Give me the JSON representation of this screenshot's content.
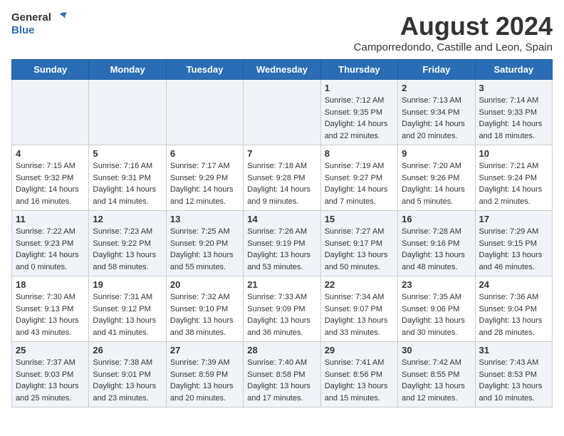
{
  "header": {
    "logo_line1": "General",
    "logo_line2": "Blue",
    "month_year": "August 2024",
    "location": "Camporredondo, Castille and Leon, Spain"
  },
  "weekdays": [
    "Sunday",
    "Monday",
    "Tuesday",
    "Wednesday",
    "Thursday",
    "Friday",
    "Saturday"
  ],
  "weeks": [
    [
      {
        "day": "",
        "info": ""
      },
      {
        "day": "",
        "info": ""
      },
      {
        "day": "",
        "info": ""
      },
      {
        "day": "",
        "info": ""
      },
      {
        "day": "1",
        "info": "Sunrise: 7:12 AM\nSunset: 9:35 PM\nDaylight: 14 hours\nand 22 minutes."
      },
      {
        "day": "2",
        "info": "Sunrise: 7:13 AM\nSunset: 9:34 PM\nDaylight: 14 hours\nand 20 minutes."
      },
      {
        "day": "3",
        "info": "Sunrise: 7:14 AM\nSunset: 9:33 PM\nDaylight: 14 hours\nand 18 minutes."
      }
    ],
    [
      {
        "day": "4",
        "info": "Sunrise: 7:15 AM\nSunset: 9:32 PM\nDaylight: 14 hours\nand 16 minutes."
      },
      {
        "day": "5",
        "info": "Sunrise: 7:16 AM\nSunset: 9:31 PM\nDaylight: 14 hours\nand 14 minutes."
      },
      {
        "day": "6",
        "info": "Sunrise: 7:17 AM\nSunset: 9:29 PM\nDaylight: 14 hours\nand 12 minutes."
      },
      {
        "day": "7",
        "info": "Sunrise: 7:18 AM\nSunset: 9:28 PM\nDaylight: 14 hours\nand 9 minutes."
      },
      {
        "day": "8",
        "info": "Sunrise: 7:19 AM\nSunset: 9:27 PM\nDaylight: 14 hours\nand 7 minutes."
      },
      {
        "day": "9",
        "info": "Sunrise: 7:20 AM\nSunset: 9:26 PM\nDaylight: 14 hours\nand 5 minutes."
      },
      {
        "day": "10",
        "info": "Sunrise: 7:21 AM\nSunset: 9:24 PM\nDaylight: 14 hours\nand 2 minutes."
      }
    ],
    [
      {
        "day": "11",
        "info": "Sunrise: 7:22 AM\nSunset: 9:23 PM\nDaylight: 14 hours\nand 0 minutes."
      },
      {
        "day": "12",
        "info": "Sunrise: 7:23 AM\nSunset: 9:22 PM\nDaylight: 13 hours\nand 58 minutes."
      },
      {
        "day": "13",
        "info": "Sunrise: 7:25 AM\nSunset: 9:20 PM\nDaylight: 13 hours\nand 55 minutes."
      },
      {
        "day": "14",
        "info": "Sunrise: 7:26 AM\nSunset: 9:19 PM\nDaylight: 13 hours\nand 53 minutes."
      },
      {
        "day": "15",
        "info": "Sunrise: 7:27 AM\nSunset: 9:17 PM\nDaylight: 13 hours\nand 50 minutes."
      },
      {
        "day": "16",
        "info": "Sunrise: 7:28 AM\nSunset: 9:16 PM\nDaylight: 13 hours\nand 48 minutes."
      },
      {
        "day": "17",
        "info": "Sunrise: 7:29 AM\nSunset: 9:15 PM\nDaylight: 13 hours\nand 46 minutes."
      }
    ],
    [
      {
        "day": "18",
        "info": "Sunrise: 7:30 AM\nSunset: 9:13 PM\nDaylight: 13 hours\nand 43 minutes."
      },
      {
        "day": "19",
        "info": "Sunrise: 7:31 AM\nSunset: 9:12 PM\nDaylight: 13 hours\nand 41 minutes."
      },
      {
        "day": "20",
        "info": "Sunrise: 7:32 AM\nSunset: 9:10 PM\nDaylight: 13 hours\nand 38 minutes."
      },
      {
        "day": "21",
        "info": "Sunrise: 7:33 AM\nSunset: 9:09 PM\nDaylight: 13 hours\nand 36 minutes."
      },
      {
        "day": "22",
        "info": "Sunrise: 7:34 AM\nSunset: 9:07 PM\nDaylight: 13 hours\nand 33 minutes."
      },
      {
        "day": "23",
        "info": "Sunrise: 7:35 AM\nSunset: 9:06 PM\nDaylight: 13 hours\nand 30 minutes."
      },
      {
        "day": "24",
        "info": "Sunrise: 7:36 AM\nSunset: 9:04 PM\nDaylight: 13 hours\nand 28 minutes."
      }
    ],
    [
      {
        "day": "25",
        "info": "Sunrise: 7:37 AM\nSunset: 9:03 PM\nDaylight: 13 hours\nand 25 minutes."
      },
      {
        "day": "26",
        "info": "Sunrise: 7:38 AM\nSunset: 9:01 PM\nDaylight: 13 hours\nand 23 minutes."
      },
      {
        "day": "27",
        "info": "Sunrise: 7:39 AM\nSunset: 8:59 PM\nDaylight: 13 hours\nand 20 minutes."
      },
      {
        "day": "28",
        "info": "Sunrise: 7:40 AM\nSunset: 8:58 PM\nDaylight: 13 hours\nand 17 minutes."
      },
      {
        "day": "29",
        "info": "Sunrise: 7:41 AM\nSunset: 8:56 PM\nDaylight: 13 hours\nand 15 minutes."
      },
      {
        "day": "30",
        "info": "Sunrise: 7:42 AM\nSunset: 8:55 PM\nDaylight: 13 hours\nand 12 minutes."
      },
      {
        "day": "31",
        "info": "Sunrise: 7:43 AM\nSunset: 8:53 PM\nDaylight: 13 hours\nand 10 minutes."
      }
    ]
  ]
}
